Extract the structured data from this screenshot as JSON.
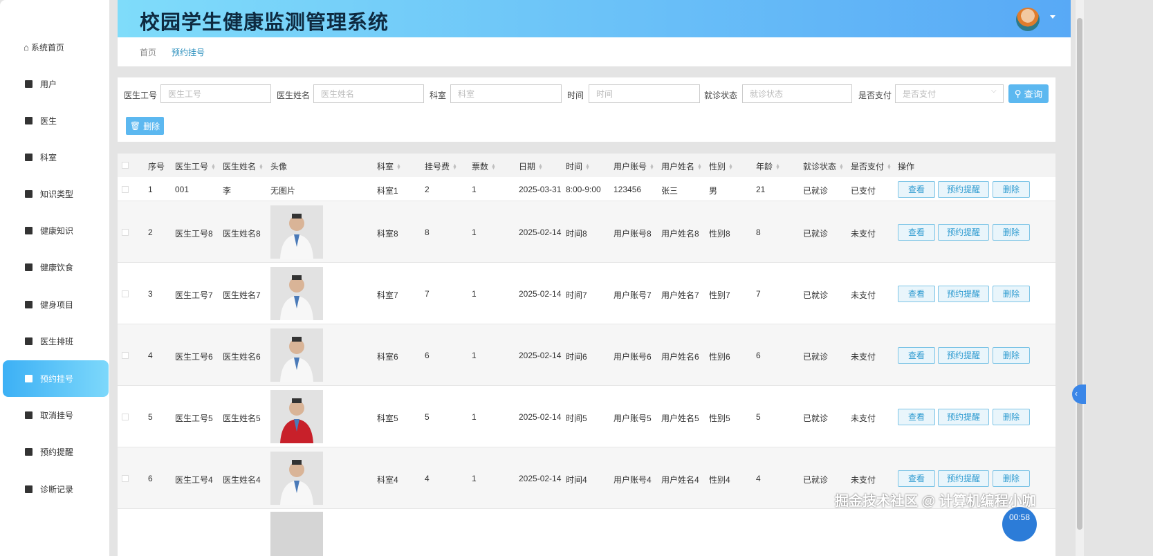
{
  "sidebar": {
    "items": [
      {
        "label": "系统首页",
        "icon": "home-icon"
      },
      {
        "label": "用户",
        "icon": "clipboard-check-icon"
      },
      {
        "label": "医生",
        "icon": "grid-icon"
      },
      {
        "label": "科室",
        "icon": "user-icon"
      },
      {
        "label": "知识类型",
        "icon": "tag-icon"
      },
      {
        "label": "健康知识",
        "icon": "chart-icon"
      },
      {
        "label": "健康饮食",
        "icon": "grid-icon"
      },
      {
        "label": "健身项目",
        "icon": "grid-icon"
      },
      {
        "label": "医生排班",
        "icon": "briefcase-icon"
      },
      {
        "label": "预约挂号",
        "icon": "grid-icon",
        "active": true
      },
      {
        "label": "取消挂号",
        "icon": "grid-icon"
      },
      {
        "label": "预约提醒",
        "icon": "bars-icon"
      },
      {
        "label": "诊断记录",
        "icon": "pin-icon"
      }
    ]
  },
  "header": {
    "title": "校园学生健康监测管理系统"
  },
  "breadcrumb": [
    "首页",
    "预约挂号"
  ],
  "search": {
    "fields": [
      {
        "label": "医生工号",
        "placeholder": "医生工号"
      },
      {
        "label": "医生姓名",
        "placeholder": "医生姓名"
      },
      {
        "label": "科室",
        "placeholder": "科室"
      },
      {
        "label": "时间",
        "placeholder": "时间"
      },
      {
        "label": "就诊状态",
        "placeholder": "就诊状态"
      },
      {
        "label": "是否支付",
        "placeholder": "是否支付"
      }
    ],
    "query_label": "查询",
    "delete_label": "删除"
  },
  "table": {
    "columns": [
      "序号",
      "医生工号",
      "医生姓名",
      "头像",
      "科室",
      "挂号费",
      "票数",
      "日期",
      "时间",
      "用户账号",
      "用户姓名",
      "性别",
      "年龄",
      "就诊状态",
      "是否支付",
      "操作"
    ],
    "rows": [
      [
        "1",
        "001",
        "李",
        "无图片",
        "科室1",
        "2",
        "1",
        "2025-03-31",
        "8:00-9:00",
        "123456",
        "张三",
        "男",
        "21",
        "已就诊",
        "已支付"
      ],
      [
        "2",
        "医生工号8",
        "医生姓名8",
        "",
        "科室8",
        "8",
        "1",
        "2025-02-14",
        "时间8",
        "用户账号8",
        "用户姓名8",
        "性别8",
        "8",
        "已就诊",
        "未支付"
      ],
      [
        "3",
        "医生工号7",
        "医生姓名7",
        "",
        "科室7",
        "7",
        "1",
        "2025-02-14",
        "时间7",
        "用户账号7",
        "用户姓名7",
        "性别7",
        "7",
        "已就诊",
        "未支付"
      ],
      [
        "4",
        "医生工号6",
        "医生姓名6",
        "",
        "科室6",
        "6",
        "1",
        "2025-02-14",
        "时间6",
        "用户账号6",
        "用户姓名6",
        "性别6",
        "6",
        "已就诊",
        "未支付"
      ],
      [
        "5",
        "医生工号5",
        "医生姓名5",
        "",
        "科室5",
        "5",
        "1",
        "2025-02-14",
        "时间5",
        "用户账号5",
        "用户姓名5",
        "性别5",
        "5",
        "已就诊",
        "未支付"
      ],
      [
        "6",
        "医生工号4",
        "医生姓名4",
        "",
        "科室4",
        "4",
        "1",
        "2025-02-14",
        "时间4",
        "用户账号4",
        "用户姓名4",
        "性别4",
        "4",
        "已就诊",
        "未支付"
      ]
    ],
    "actions": [
      "查看",
      "预约提醒",
      "删除"
    ]
  },
  "overlay": {
    "watermark": "掘金技术社区 @ 计算机编程小咖",
    "timer": "00:58"
  }
}
